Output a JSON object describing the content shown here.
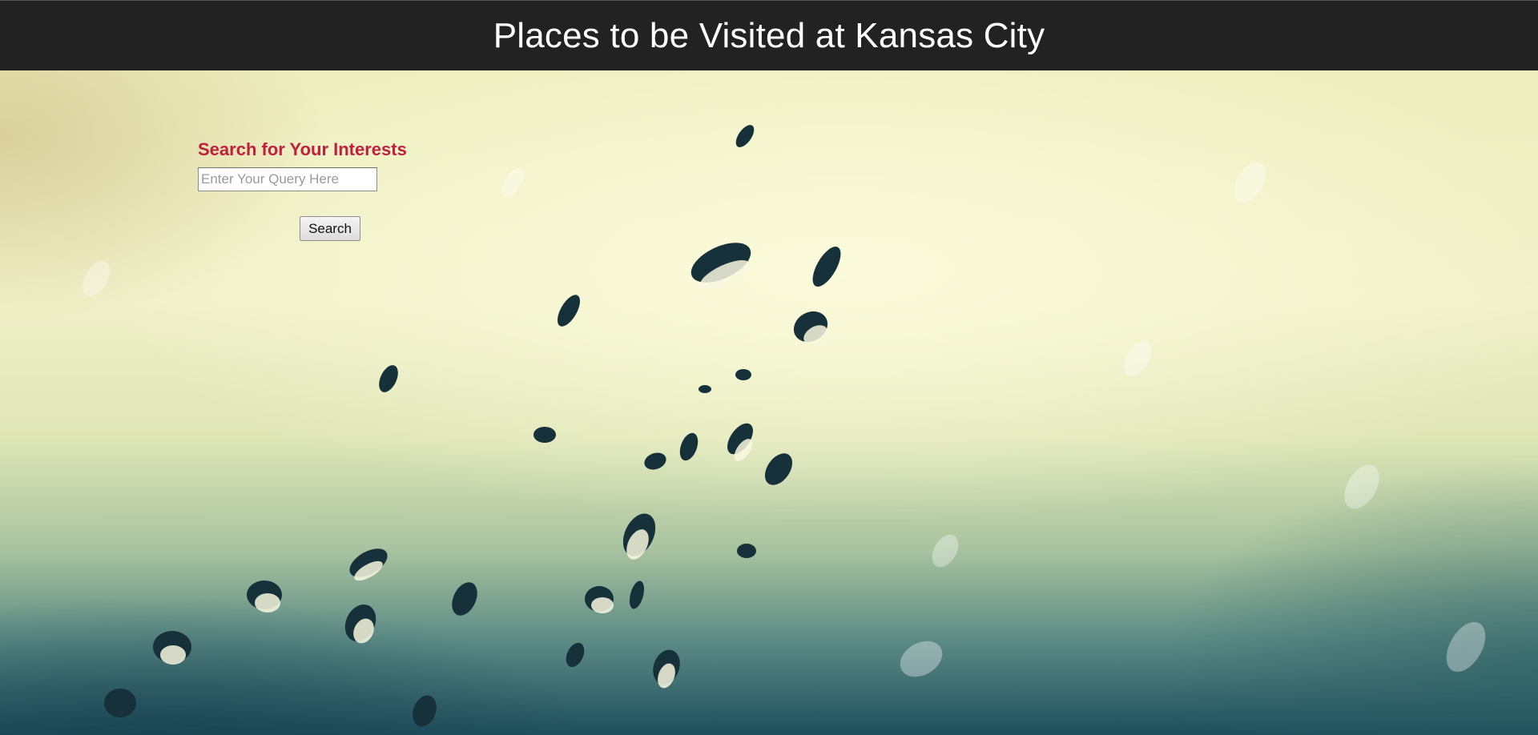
{
  "header": {
    "title": "Places to be Visited at Kansas City"
  },
  "search": {
    "heading": "Search for Your Interests",
    "placeholder": "Enter Your Query Here",
    "value": "",
    "button_label": "Search"
  },
  "colors": {
    "header_bg": "#222222",
    "header_text": "#ffffff",
    "heading_accent": "#c0203c"
  }
}
